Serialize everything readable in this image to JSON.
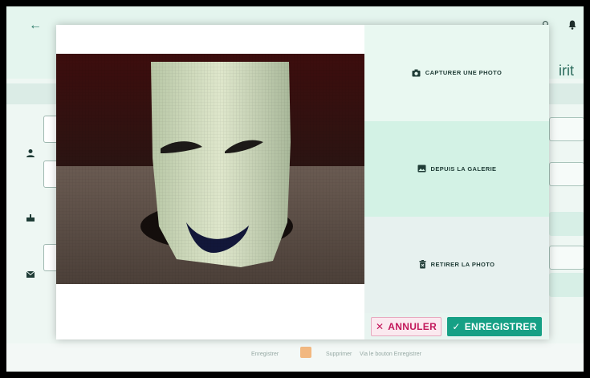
{
  "background_app": {
    "title_fragment": "irit",
    "footer": {
      "save_label": "Enregistrer",
      "delete_label": "Supprimer",
      "hint_text": "Via le bouton Enregistrer"
    }
  },
  "modal": {
    "options": [
      {
        "label": "CAPTURER UNE PHOTO",
        "icon": "camera-icon"
      },
      {
        "label": "DEPUIS LA GALERIE",
        "icon": "image-icon"
      },
      {
        "label": "RETIRER LA PHOTO",
        "icon": "trash-icon"
      }
    ],
    "cancel_label": "ANNULER",
    "save_label": "ENREGISTRER"
  },
  "colors": {
    "accent": "#16a085",
    "cancel": "#c2185b",
    "option_1_bg": "#e9f8f1",
    "option_2_bg": "#d3f2e5",
    "option_3_bg": "#e7f1ef"
  }
}
